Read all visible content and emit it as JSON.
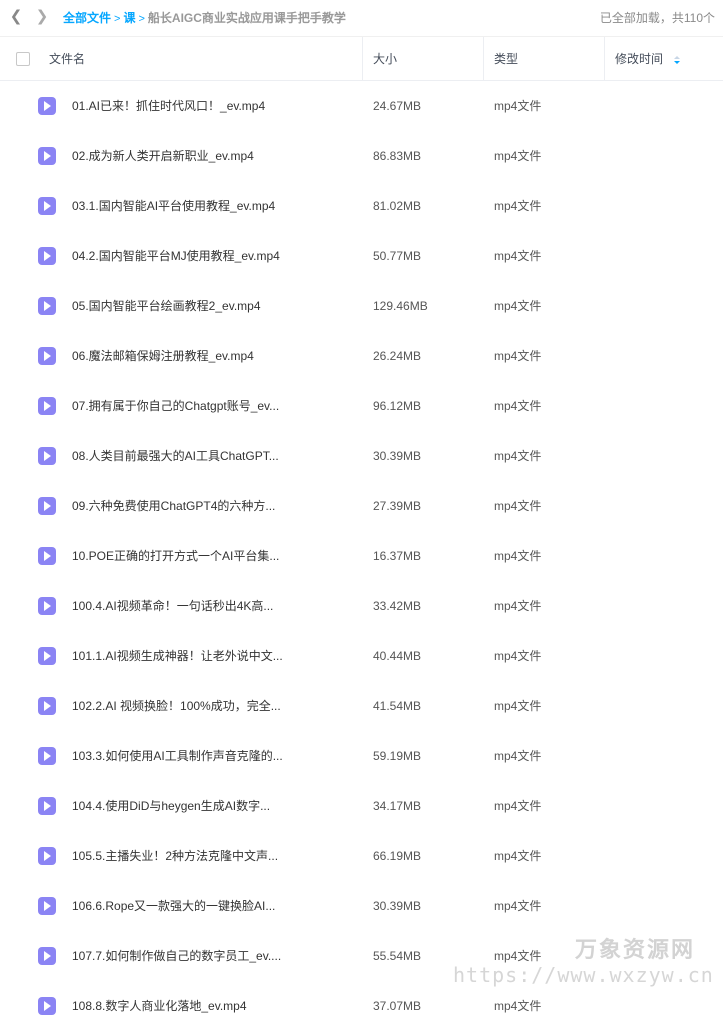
{
  "breadcrumb": {
    "root": "全部文件",
    "level1": "课",
    "current": "船长AIGC商业实战应用课手把手教学"
  },
  "status_text": "已全部加载，共110个",
  "columns": {
    "name": "文件名",
    "size": "大小",
    "type": "类型",
    "modified": "修改时间"
  },
  "icons": {
    "back": "chevron-left-icon",
    "forward": "chevron-right-icon",
    "file": "video-file-icon",
    "sort": "sort-desc-icon"
  },
  "colors": {
    "accent": "#06a7ff",
    "file_icon": "#8b84f4"
  },
  "files": [
    {
      "name": "01.AI已来！抓住时代风口！_ev.mp4",
      "size": "24.67MB",
      "type": "mp4文件"
    },
    {
      "name": "02.成为新人类开启新职业_ev.mp4",
      "size": "86.83MB",
      "type": "mp4文件"
    },
    {
      "name": "03.1.国内智能AI平台使用教程_ev.mp4",
      "size": "81.02MB",
      "type": "mp4文件"
    },
    {
      "name": "04.2.国内智能平台MJ使用教程_ev.mp4",
      "size": "50.77MB",
      "type": "mp4文件"
    },
    {
      "name": "05.国内智能平台绘画教程2_ev.mp4",
      "size": "129.46MB",
      "type": "mp4文件"
    },
    {
      "name": "06.魔法邮箱保姆注册教程_ev.mp4",
      "size": "26.24MB",
      "type": "mp4文件"
    },
    {
      "name": "07.拥有属于你自己的Chatgpt账号_ev...",
      "size": "96.12MB",
      "type": "mp4文件"
    },
    {
      "name": "08.人类目前最强大的AI工具ChatGPT...",
      "size": "30.39MB",
      "type": "mp4文件"
    },
    {
      "name": "09.六种免费使用ChatGPT4的六种方...",
      "size": "27.39MB",
      "type": "mp4文件"
    },
    {
      "name": "10.POE正确的打开方式一个AI平台集...",
      "size": "16.37MB",
      "type": "mp4文件"
    },
    {
      "name": "100.4.AI视频革命！一句话秒出4K高...",
      "size": "33.42MB",
      "type": "mp4文件"
    },
    {
      "name": "101.1.AI视频生成神器！让老外说中文...",
      "size": "40.44MB",
      "type": "mp4文件"
    },
    {
      "name": "102.2.AI 视频换脸！100%成功，完全...",
      "size": "41.54MB",
      "type": "mp4文件"
    },
    {
      "name": "103.3.如何使用AI工具制作声音克隆的...",
      "size": "59.19MB",
      "type": "mp4文件"
    },
    {
      "name": "104.4.使用DiD与heygen生成AI数字...",
      "size": "34.17MB",
      "type": "mp4文件"
    },
    {
      "name": "105.5.主播失业！2种方法克隆中文声...",
      "size": "66.19MB",
      "type": "mp4文件"
    },
    {
      "name": "106.6.Rope又一款强大的一键换脸AI...",
      "size": "30.39MB",
      "type": "mp4文件"
    },
    {
      "name": "107.7.如何制作做自己的数字员工_ev....",
      "size": "55.54MB",
      "type": "mp4文件"
    },
    {
      "name": "108.8.数字人商业化落地_ev.mp4",
      "size": "37.07MB",
      "type": "mp4文件"
    }
  ],
  "watermark": {
    "line1": "万象资源网",
    "line2": "https://www.wxzyw.cn"
  }
}
